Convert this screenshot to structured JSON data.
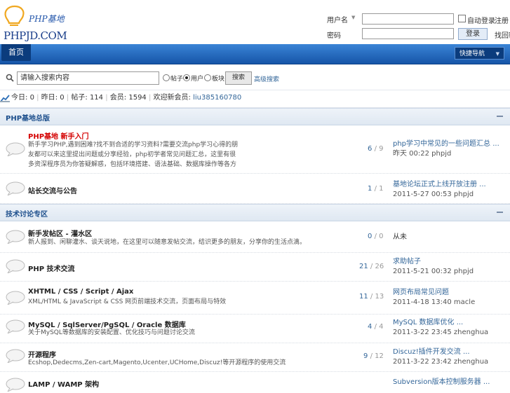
{
  "header": {
    "logo_main": "PHPJD.COM",
    "logo_sub": "PHP基地",
    "username_label": "用户名",
    "password_label": "密码",
    "remember_label": "自动登录",
    "register_link": "注册",
    "forgot_link": "找回密码",
    "login_button": "登录"
  },
  "nav": {
    "home": "首页",
    "quick_nav": "快捷导航"
  },
  "search": {
    "input_value": "请输入搜索内容",
    "options": [
      "帖子",
      "用户",
      "板块"
    ],
    "button": "搜索",
    "advanced": "高级搜索"
  },
  "stats": {
    "today_label": "今日",
    "today": "0",
    "yesterday_label": "昨日",
    "yesterday": "0",
    "topics_label": "帖子",
    "topics": "114",
    "members_label": "会员",
    "members": "1594",
    "newest_label": "欢迎新会员",
    "newest": "liu385160780"
  },
  "categories": [
    {
      "title": "PHP基地总版",
      "forums": [
        {
          "name": "PHP基地 新手入门",
          "red": true,
          "desc": "新手学习PHP,遇到困难?找不到合适的学习资料?需要交流php学习心得的朋友都可以来这里提出问题或分享经验，php初学者常见问题汇总，这里有很多资深程序员为你答疑解惑，包括环境搭建、语法基础、数据库操作等各方面内容，欢迎大家积极参与讨论,共同进步,让我们一起学习成长，每天都有新的收获和进步。还等什么?快来www.phpjd.com注册加入我们吧。",
          "topics": "6",
          "posts": "9",
          "last_title": "php学习中常见的一些问题汇总 ...",
          "last_meta": "昨天 00:22 phpjd"
        },
        {
          "name": "站长交流与公告",
          "red": false,
          "desc": "",
          "topics": "1",
          "posts": "1",
          "last_title": "基地论坛正式上线开放注册 ...",
          "last_meta": "2011-5-27 00:53 phpjd"
        }
      ]
    },
    {
      "title": "技术讨论专区",
      "forums": [
        {
          "name": "新手发帖区 - 灌水区",
          "red": false,
          "desc": "新人报到、闲聊灌水、谈天说地，在这里可以随意发帖交流，结识更多的朋友，分享你的生活点滴。",
          "topics": "0",
          "posts": "0",
          "last_title": "从未",
          "last_meta": ""
        },
        {
          "name": "PHP 技术交流",
          "red": false,
          "desc": "",
          "topics": "21",
          "posts": "26",
          "last_title": "求助帖子",
          "last_meta": "2011-5-21 00:32 phpjd"
        },
        {
          "name": "XHTML / CSS / Script / Ajax",
          "red": false,
          "desc": "XML/HTML & JavaScript & CSS 网页前端技术交流，页面布局与特效",
          "topics": "11",
          "posts": "13",
          "last_title": "网页布局常见问题",
          "last_meta": "2011-4-18 13:40 macle"
        },
        {
          "name": "MySQL / SqlServer/PgSQL / Oracle 数据库",
          "red": false,
          "desc": "关于MySQL等数据库的安装配置、优化技巧与问题讨论交流",
          "topics": "4",
          "posts": "4",
          "last_title": "MySQL 数据库优化 ...",
          "last_meta": "2011-3-22 23:45 zhenghua"
        },
        {
          "name": "开源程序",
          "red": false,
          "desc": "Ecshop,Dedecms,Zen-cart,Magento,Ucenter,UCHome,Discuz!等开源程序的使用交流",
          "topics": "9",
          "posts": "12",
          "last_title": "Discuz!插件开发交流 ...",
          "last_meta": "2011-3-22 23:42 zhenghua"
        },
        {
          "name": "LAMP / WAMP 架构",
          "red": false,
          "desc": "",
          "topics": "",
          "posts": "",
          "last_title": "Subversion版本控制服务器 ...",
          "last_meta": ""
        }
      ]
    }
  ],
  "colors": {
    "nav_blue": "#1e63b8",
    "link": "#336699",
    "red": "#d40000"
  }
}
